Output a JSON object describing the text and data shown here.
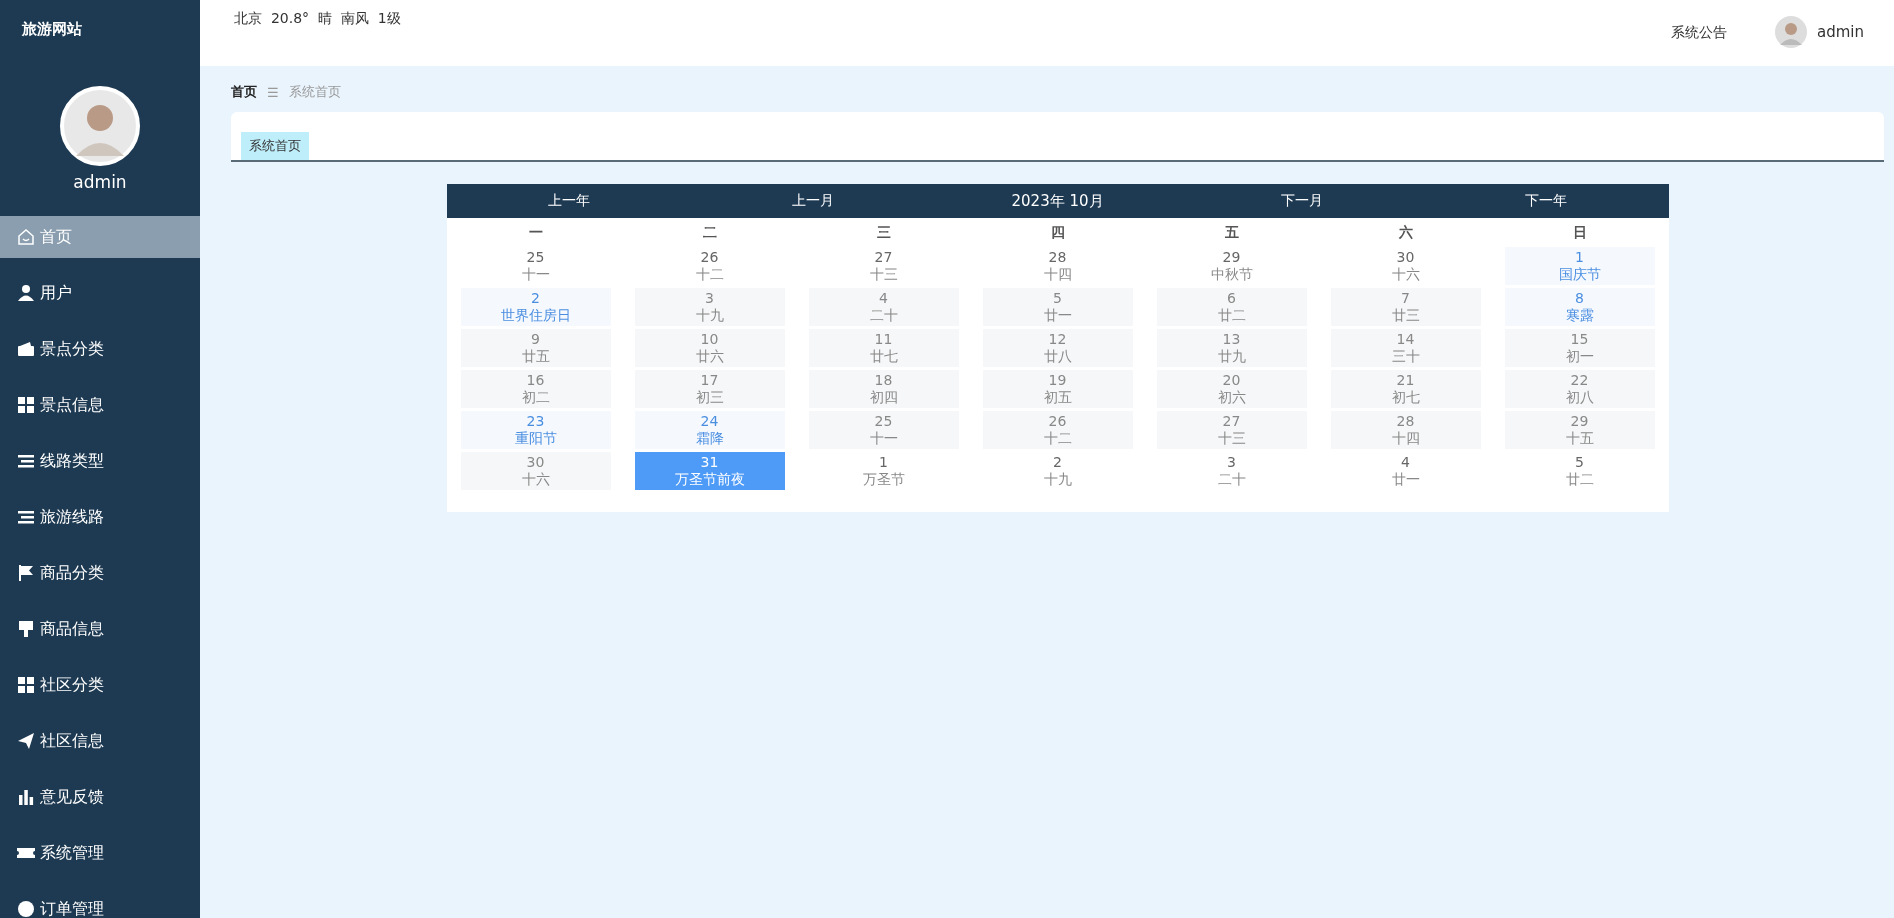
{
  "sidebar": {
    "brand": "旅游网站",
    "user": "admin",
    "items": [
      {
        "label": "首页",
        "selected": true
      },
      {
        "label": "用户",
        "selected": false
      },
      {
        "label": "景点分类",
        "selected": false
      },
      {
        "label": "景点信息",
        "selected": false
      },
      {
        "label": "线路类型",
        "selected": false
      },
      {
        "label": "旅游线路",
        "selected": false
      },
      {
        "label": "商品分类",
        "selected": false
      },
      {
        "label": "商品信息",
        "selected": false
      },
      {
        "label": "社区分类",
        "selected": false
      },
      {
        "label": "社区信息",
        "selected": false
      },
      {
        "label": "意见反馈",
        "selected": false
      },
      {
        "label": "系统管理",
        "selected": false
      },
      {
        "label": "订单管理",
        "selected": false
      }
    ]
  },
  "topbar": {
    "weather": "北京  20.8°  晴  南风  1级",
    "notice": "系统公告",
    "user": "admin"
  },
  "breadcrumb": {
    "home": "首页",
    "separator": "☰",
    "current": "系统首页"
  },
  "tabs": [
    {
      "label": "系统首页",
      "selected": true
    }
  ],
  "calendar": {
    "nav": [
      "上一年",
      "上一月",
      "2023年 10月",
      "下一月",
      "下一年"
    ],
    "weekdays": [
      "一",
      "二",
      "三",
      "四",
      "五",
      "六",
      "日"
    ],
    "weeks": [
      [
        {
          "day": "25",
          "lunar": "十一",
          "kind": "outside"
        },
        {
          "day": "26",
          "lunar": "十二",
          "kind": "outside"
        },
        {
          "day": "27",
          "lunar": "十三",
          "kind": "outside"
        },
        {
          "day": "28",
          "lunar": "十四",
          "kind": "outside"
        },
        {
          "day": "29",
          "lunar": "中秋节",
          "kind": "outside"
        },
        {
          "day": "30",
          "lunar": "十六",
          "kind": "outside"
        },
        {
          "day": "1",
          "lunar": "国庆节",
          "kind": "holiday"
        }
      ],
      [
        {
          "day": "2",
          "lunar": "世界住房日",
          "kind": "holiday"
        },
        {
          "day": "3",
          "lunar": "十九",
          "kind": "normal"
        },
        {
          "day": "4",
          "lunar": "二十",
          "kind": "normal"
        },
        {
          "day": "5",
          "lunar": "廿一",
          "kind": "normal"
        },
        {
          "day": "6",
          "lunar": "廿二",
          "kind": "normal"
        },
        {
          "day": "7",
          "lunar": "廿三",
          "kind": "normal"
        },
        {
          "day": "8",
          "lunar": "寒露",
          "kind": "holiday"
        }
      ],
      [
        {
          "day": "9",
          "lunar": "廿五",
          "kind": "normal"
        },
        {
          "day": "10",
          "lunar": "廿六",
          "kind": "normal"
        },
        {
          "day": "11",
          "lunar": "廿七",
          "kind": "normal"
        },
        {
          "day": "12",
          "lunar": "廿八",
          "kind": "normal"
        },
        {
          "day": "13",
          "lunar": "廿九",
          "kind": "normal"
        },
        {
          "day": "14",
          "lunar": "三十",
          "kind": "normal"
        },
        {
          "day": "15",
          "lunar": "初一",
          "kind": "normal"
        }
      ],
      [
        {
          "day": "16",
          "lunar": "初二",
          "kind": "normal"
        },
        {
          "day": "17",
          "lunar": "初三",
          "kind": "normal"
        },
        {
          "day": "18",
          "lunar": "初四",
          "kind": "normal"
        },
        {
          "day": "19",
          "lunar": "初五",
          "kind": "normal"
        },
        {
          "day": "20",
          "lunar": "初六",
          "kind": "normal"
        },
        {
          "day": "21",
          "lunar": "初七",
          "kind": "normal"
        },
        {
          "day": "22",
          "lunar": "初八",
          "kind": "normal"
        }
      ],
      [
        {
          "day": "23",
          "lunar": "重阳节",
          "kind": "holiday"
        },
        {
          "day": "24",
          "lunar": "霜降",
          "kind": "holiday"
        },
        {
          "day": "25",
          "lunar": "十一",
          "kind": "normal"
        },
        {
          "day": "26",
          "lunar": "十二",
          "kind": "normal"
        },
        {
          "day": "27",
          "lunar": "十三",
          "kind": "normal"
        },
        {
          "day": "28",
          "lunar": "十四",
          "kind": "normal"
        },
        {
          "day": "29",
          "lunar": "十五",
          "kind": "normal"
        }
      ],
      [
        {
          "day": "30",
          "lunar": "十六",
          "kind": "normal"
        },
        {
          "day": "31",
          "lunar": "万圣节前夜",
          "kind": "today"
        },
        {
          "day": "1",
          "lunar": "万圣节",
          "kind": "outside"
        },
        {
          "day": "2",
          "lunar": "十九",
          "kind": "outside"
        },
        {
          "day": "3",
          "lunar": "二十",
          "kind": "outside"
        },
        {
          "day": "4",
          "lunar": "廿一",
          "kind": "outside"
        },
        {
          "day": "5",
          "lunar": "廿二",
          "kind": "outside"
        }
      ]
    ]
  }
}
